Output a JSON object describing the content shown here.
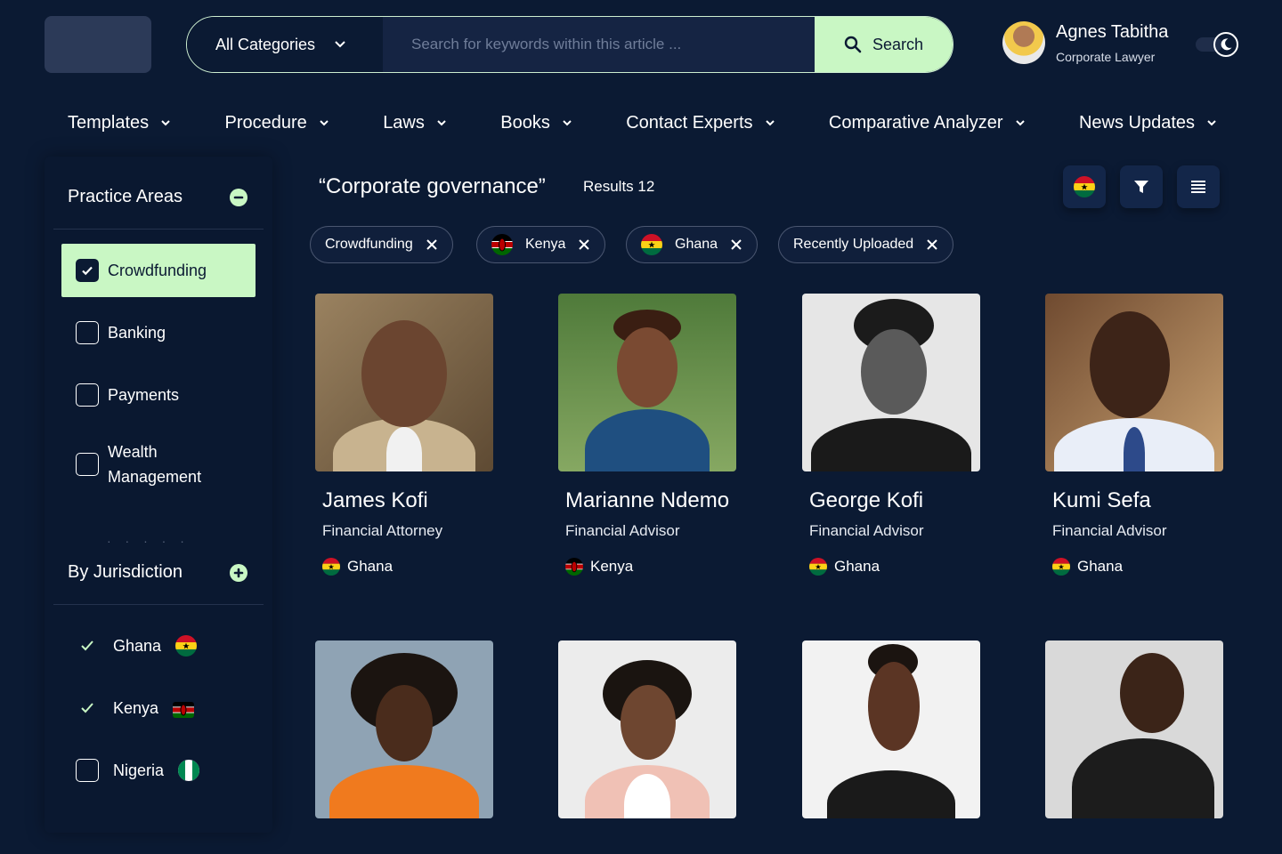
{
  "header": {
    "category_label": "All Categories",
    "search_placeholder": "Search for keywords within this article ...",
    "search_button": "Search",
    "user_name": "Agnes Tabitha",
    "user_role": "Corporate Lawyer"
  },
  "nav": [
    {
      "label": "Templates"
    },
    {
      "label": "Procedure"
    },
    {
      "label": "Laws"
    },
    {
      "label": "Books"
    },
    {
      "label": "Contact Experts"
    },
    {
      "label": "Comparative Analyzer"
    },
    {
      "label": "News Updates"
    }
  ],
  "sidebar": {
    "practice_title": "Practice Areas",
    "practice_items": [
      {
        "label": "Crowdfunding",
        "checked": true
      },
      {
        "label": "Banking",
        "checked": false
      },
      {
        "label": "Payments",
        "checked": false
      },
      {
        "label": "Wealth Management",
        "checked": false
      }
    ],
    "jurisdiction_title": "By Jurisdiction",
    "jurisdictions": [
      {
        "label": "Ghana",
        "checked": true,
        "flag": "ghana-flag"
      },
      {
        "label": "Kenya",
        "checked": true,
        "flag": "kenya-flag"
      },
      {
        "label": "Nigeria",
        "checked": false,
        "flag": "nigeria-flag"
      }
    ]
  },
  "results": {
    "query": "“Corporate governance”",
    "count_label": "Results 12"
  },
  "filters": [
    {
      "label": "Crowdfunding"
    },
    {
      "label": "Kenya",
      "flag": "kenya-flag"
    },
    {
      "label": "Ghana",
      "flag": "ghana-flag"
    },
    {
      "label": "Recently Uploaded"
    }
  ],
  "experts": [
    {
      "name": "James Kofi",
      "role": "Financial Attorney",
      "country": "Ghana"
    },
    {
      "name": "Marianne Ndemo",
      "role": "Financial Advisor",
      "country": "Kenya"
    },
    {
      "name": "George Kofi",
      "role": "Financial Advisor",
      "country": "Ghana"
    },
    {
      "name": "Kumi Sefa",
      "role": "Financial Advisor",
      "country": "Ghana"
    }
  ],
  "colors": {
    "background": "#0b1a33",
    "accent": "#c9f7c4",
    "panel": "#0a1830"
  }
}
